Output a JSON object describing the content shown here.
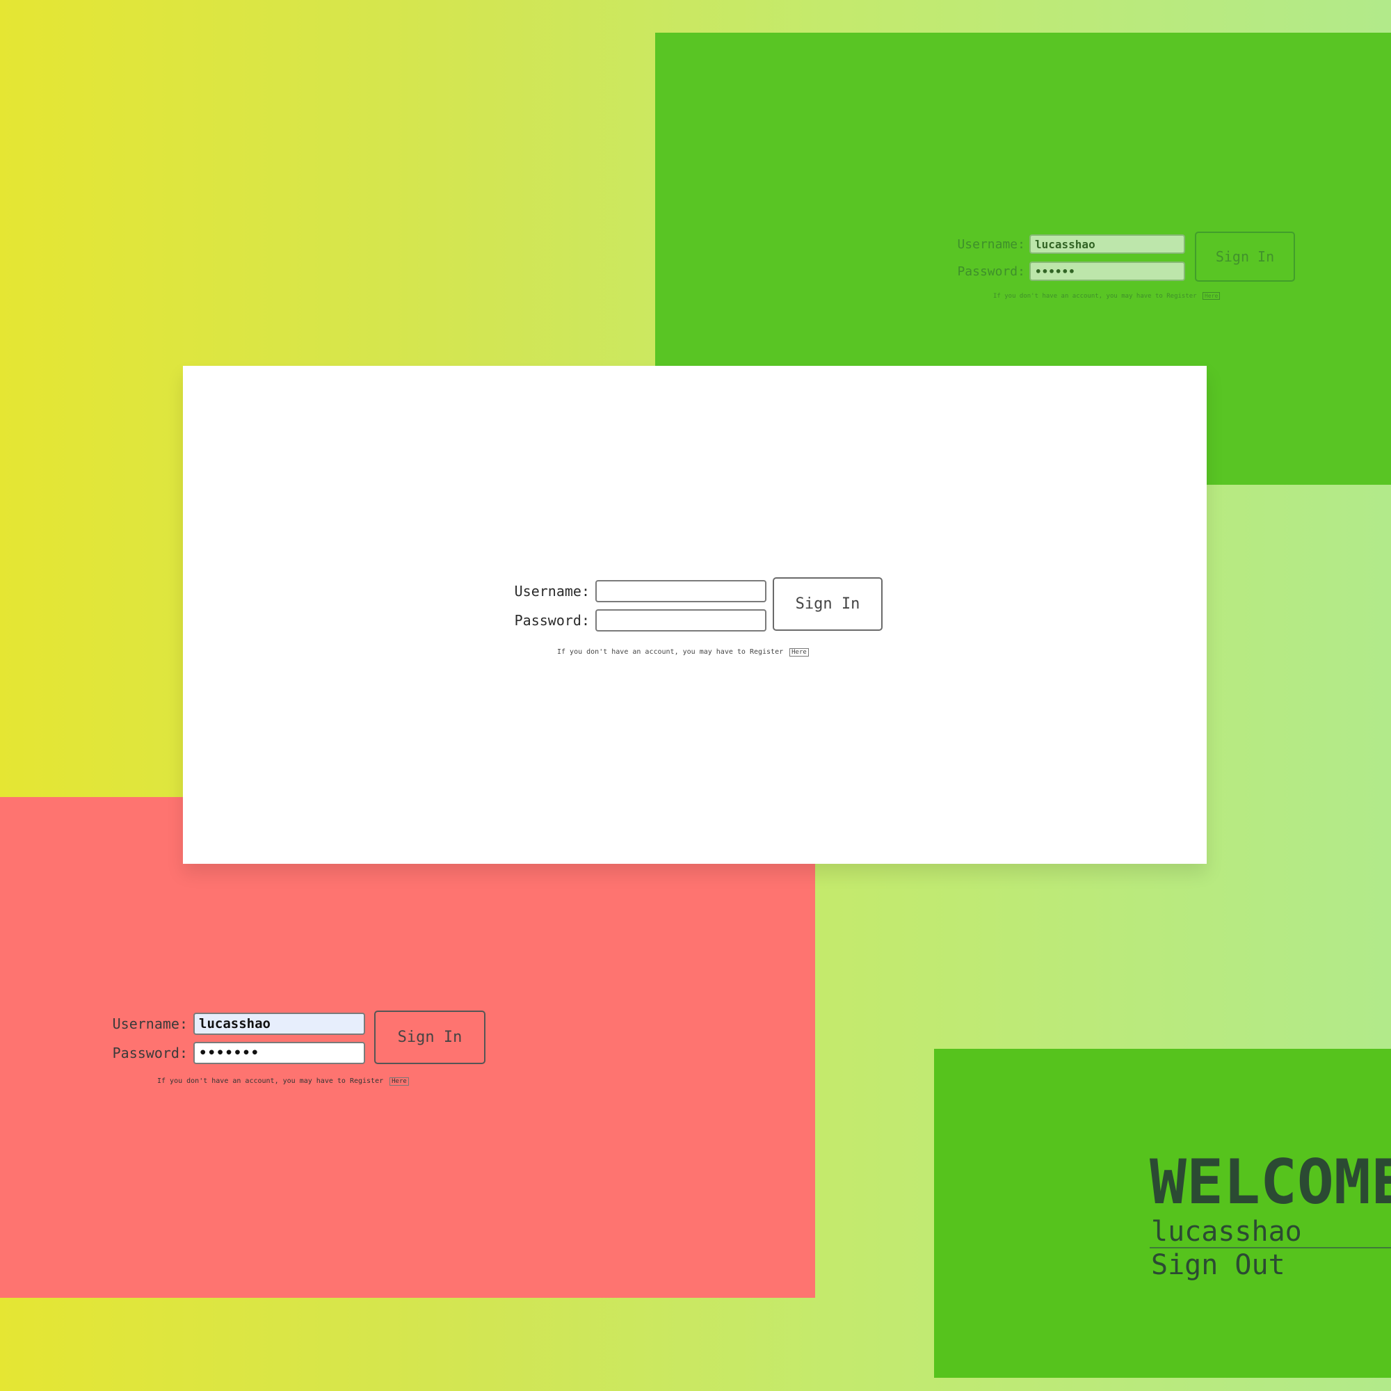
{
  "panels": {
    "top_right": {
      "background": "#59c524",
      "form": {
        "username_label": "Username:",
        "password_label": "Password:",
        "username_value": "lucasshao",
        "password_value": "••••••",
        "signin_label": "Sign In",
        "note_text": "If you don't have an account, you may have to Register",
        "here_label": "Here"
      }
    },
    "center": {
      "background": "#ffffff",
      "form": {
        "username_label": "Username:",
        "password_label": "Password:",
        "username_value": "",
        "password_value": "",
        "signin_label": "Sign In",
        "note_text": "If you don't have an account, you may have to Register",
        "here_label": "Here"
      }
    },
    "bottom_left": {
      "background": "#fe7470",
      "form": {
        "username_label": "Username:",
        "password_label": "Password:",
        "username_value": "lucasshao",
        "password_value": "•••••••",
        "signin_label": "Sign In",
        "note_text": "If you don't have an account, you may have to Register",
        "here_label": "Here"
      }
    },
    "bottom_right": {
      "background": "#56c31d",
      "welcome": {
        "title": "WELCOME",
        "username": "lucasshao",
        "signout_label": "Sign Out"
      }
    }
  },
  "colors": {
    "background_gradient_start": "#e5e633",
    "background_gradient_end": "#b2ea8a",
    "text_dark": "#2b4a33"
  }
}
